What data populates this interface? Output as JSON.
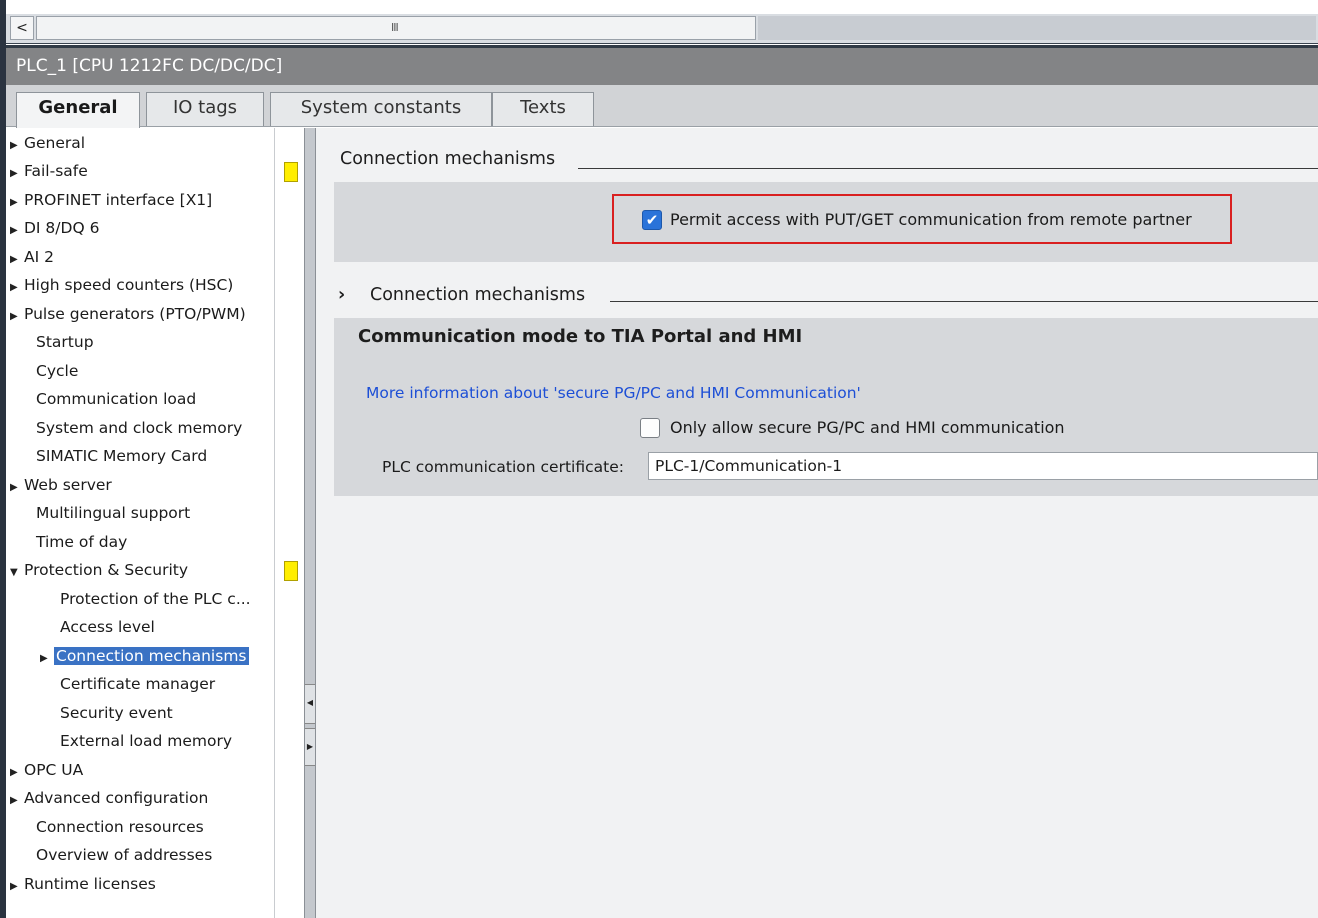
{
  "scrollbar": {
    "left_arrow": "<",
    "grip": "III"
  },
  "window": {
    "title": "PLC_1 [CPU 1212FC DC/DC/DC]"
  },
  "tabs": [
    {
      "label": "General"
    },
    {
      "label": "IO tags"
    },
    {
      "label": "System constants"
    },
    {
      "label": "Texts"
    }
  ],
  "nav": {
    "items": [
      {
        "label": "General"
      },
      {
        "label": "Fail-safe"
      },
      {
        "label": "PROFINET interface [X1]"
      },
      {
        "label": "DI 8/DQ 6"
      },
      {
        "label": "AI 2"
      },
      {
        "label": "High speed counters (HSC)"
      },
      {
        "label": "Pulse generators (PTO/PWM)"
      },
      {
        "label": "Startup"
      },
      {
        "label": "Cycle"
      },
      {
        "label": "Communication load"
      },
      {
        "label": "System and clock memory"
      },
      {
        "label": "SIMATIC Memory Card"
      },
      {
        "label": "Web server"
      },
      {
        "label": "Multilingual support"
      },
      {
        "label": "Time of day"
      },
      {
        "label": "Protection & Security"
      },
      {
        "label": "Protection of the PLC c..."
      },
      {
        "label": "Access level"
      },
      {
        "label": "Connection mechanisms"
      },
      {
        "label": "Certificate manager"
      },
      {
        "label": "Security event"
      },
      {
        "label": "External load memory"
      },
      {
        "label": "OPC UA"
      },
      {
        "label": "Advanced configuration"
      },
      {
        "label": "Connection resources"
      },
      {
        "label": "Overview of addresses"
      },
      {
        "label": "Runtime licenses"
      }
    ]
  },
  "main": {
    "section1": {
      "title": "Connection mechanisms",
      "put_get_label": "Permit access with PUT/GET communication from remote partner",
      "put_get_checked": true
    },
    "section2": {
      "chevron": "›",
      "title": "Connection mechanisms",
      "panel_title": "Communication mode to TIA Portal and HMI",
      "info_link": "More information about 'secure PG/PC and HMI Communication'",
      "secure_label": "Only allow secure PG/PC and HMI communication",
      "secure_checked": false,
      "cert_label": "PLC communication certificate:",
      "cert_value": "PLC-1/Communication-1"
    }
  },
  "colors": {
    "flag": "#ffee00",
    "selection": "#3a72c4",
    "highlight_border": "#d92020",
    "link": "#1d4fd6"
  }
}
